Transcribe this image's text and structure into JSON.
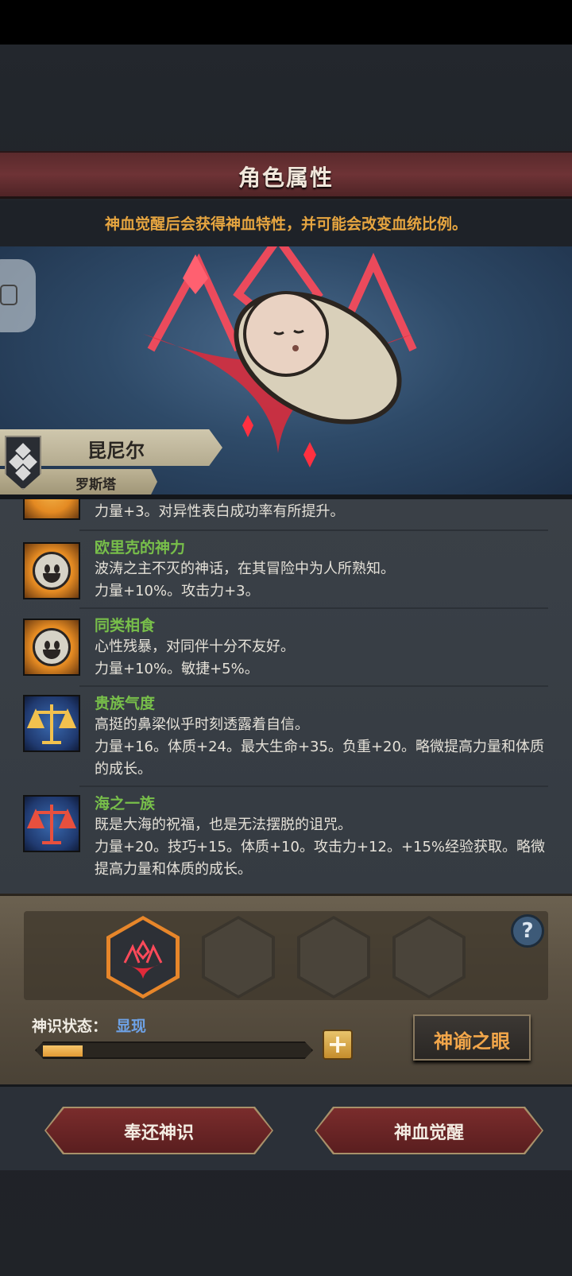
{
  "header": {
    "title": "角色属性"
  },
  "notice": "神血觉醒后会获得神血特性，并可能会改变血统比例。",
  "character": {
    "name": "昆尼尔",
    "origin": "罗斯塔"
  },
  "traits": [
    {
      "icon": "smiling-face-icon",
      "name": "",
      "desc_line1": "...",
      "desc_line2": "力量+3。对异性表白成功率有所提升。"
    },
    {
      "icon": "smiling-face-icon",
      "name": "欧里克的神力",
      "desc_line1": "波涛之主不灭的神话，在其冒险中为人所熟知。",
      "desc_line2": "力量+10%。攻击力+3。"
    },
    {
      "icon": "smiling-face-icon",
      "name": "同类相食",
      "desc_line1": "心性残暴，对同伴十分不友好。",
      "desc_line2": "力量+10%。敏捷+5%。"
    },
    {
      "icon": "golden-scale-icon",
      "name": "贵族气度",
      "desc_line1": "高挺的鼻梁似乎时刻透露着自信。",
      "desc_line2": "力量+16。体质+24。最大生命+35。负重+20。略微提高力量和体质的成长。"
    },
    {
      "icon": "red-scale-icon",
      "name": "海之一族",
      "desc_line1": "既是大海的祝福，也是无法摆脱的诅咒。",
      "desc_line2": "力量+20。技巧+15。体质+10。攻击力+12。+15%经验获取。略微提高力量和体质的成长。"
    }
  ],
  "divinity": {
    "status_label": "神识状态：",
    "status_value": "显现",
    "progress": 0.15,
    "plus_label": "+",
    "help_label": "?",
    "oracle_button": "神谕之眼"
  },
  "actions": {
    "return_label": "奉还神识",
    "awaken_label": "神血觉醒"
  },
  "colors": {
    "accent": "#e7862a",
    "trait_name": "#78bf4a",
    "status_value": "#6ea2e6",
    "notice": "#e6a540"
  }
}
